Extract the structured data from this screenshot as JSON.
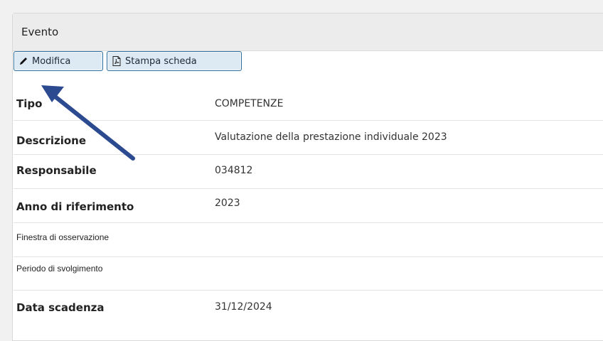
{
  "panel": {
    "title": "Evento"
  },
  "toolbar": {
    "edit_label": "Modifica",
    "print_label": "Stampa scheda"
  },
  "fields": [
    {
      "label": "Tipo",
      "value": "COMPETENZE"
    },
    {
      "label": "Descrizione",
      "value": "Valutazione della prestazione individuale 2023"
    },
    {
      "label": "Responsabile",
      "value": "034812"
    },
    {
      "label": "Anno di riferimento",
      "value": "2023"
    },
    {
      "label": "Finestra di osservazione",
      "value": ""
    },
    {
      "label": "Periodo di svolgimento",
      "value": ""
    },
    {
      "label": "Data scadenza",
      "value": "31/12/2024"
    }
  ],
  "colors": {
    "arrow": "#2b4a8f",
    "button_border": "#2f6f9f",
    "button_bg": "#dde9f3"
  }
}
